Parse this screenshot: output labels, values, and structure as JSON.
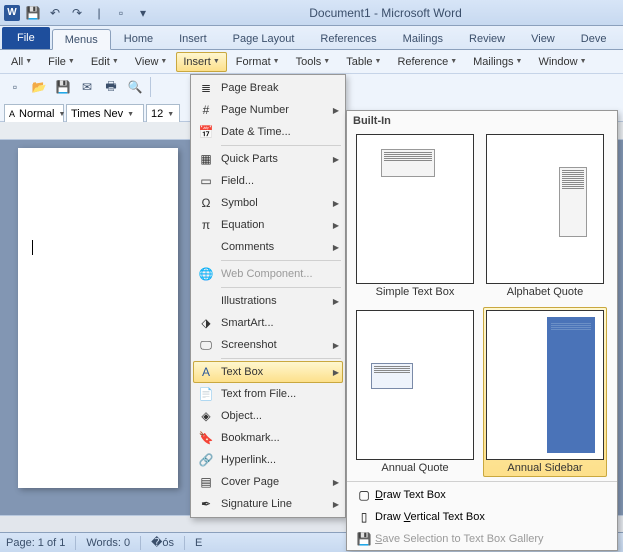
{
  "title": "Document1 - Microsoft Word",
  "tabs": {
    "file": "File",
    "menus": "Menus",
    "home": "Home",
    "insert": "Insert",
    "pagelayout": "Page Layout",
    "references": "References",
    "mailings": "Mailings",
    "review": "Review",
    "view": "View",
    "dev": "Deve"
  },
  "menubar": {
    "all": "All",
    "file": "File",
    "edit": "Edit",
    "view": "View",
    "insert": "Insert",
    "format": "Format",
    "tools": "Tools",
    "table": "Table",
    "reference": "Reference",
    "mailings": "Mailings",
    "window": "Window"
  },
  "toolbar": {
    "style": "Normal",
    "font": "Times Nev",
    "size": "12"
  },
  "status": {
    "page": "Page: 1 of 1",
    "words": "Words: 0",
    "lang": "E"
  },
  "insert_menu": {
    "page_break": "Page Break",
    "page_number": "Page Number",
    "date_time": "Date & Time...",
    "quick_parts": "Quick Parts",
    "field": "Field...",
    "symbol": "Symbol",
    "equation": "Equation",
    "comments": "Comments",
    "web_component": "Web Component...",
    "illustrations": "Illustrations",
    "smartart": "SmartArt...",
    "screenshot": "Screenshot",
    "text_box": "Text Box",
    "text_from_file": "Text from File...",
    "object": "Object...",
    "bookmark": "Bookmark...",
    "hyperlink": "Hyperlink...",
    "cover_page": "Cover Page",
    "signature_line": "Signature Line"
  },
  "gallery": {
    "header": "Built-In",
    "items": [
      {
        "caption": "Simple Text Box"
      },
      {
        "caption": "Alphabet Quote"
      },
      {
        "caption": "Annual Quote"
      },
      {
        "caption": "Annual Sidebar"
      }
    ],
    "draw": "Draw Text Box",
    "draw_v": "Draw Vertical Text Box",
    "save_sel": "Save Selection to Text Box Gallery"
  }
}
